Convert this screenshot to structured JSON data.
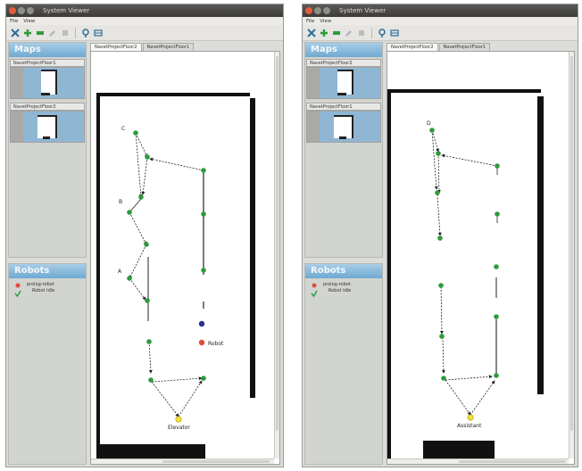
{
  "windows": [
    {
      "title": "System Viewer",
      "menu": [
        "File",
        "View"
      ],
      "maps_header": "Maps",
      "map_items": [
        "NavetProjectFloor1",
        "NavetProjectFloor2"
      ],
      "tabs": [
        "NavetProjectFloor2",
        "NavetProjectFloor1"
      ],
      "robots_header": "Robots",
      "robot_name": "prolog-robot",
      "robot_status": "Robot Idle",
      "node_labels": [
        "C",
        "B",
        "A"
      ],
      "elevator_label": "Elevator",
      "robot_label": "Robot"
    },
    {
      "title": "System Viewer",
      "menu": [
        "File",
        "View"
      ],
      "maps_header": "Maps",
      "map_items": [
        "NavetProjectFloor2",
        "NavetProjectFloor1"
      ],
      "tabs": [
        "NavetProjectFloor2",
        "NavetProjectFloor1"
      ],
      "robots_header": "Robots",
      "robot_name": "prolog-robot",
      "robot_status": "Robot Idle",
      "node_labels": [
        "D"
      ],
      "elevator_label": "Assistant"
    }
  ],
  "colors": {
    "node": "#2e9a3a",
    "elevator": "#f2e23a",
    "robot_marker_top": "#2b2f8f",
    "robot_marker_bottom": "#e24b3a",
    "header_blue": "#6fa9d2"
  }
}
